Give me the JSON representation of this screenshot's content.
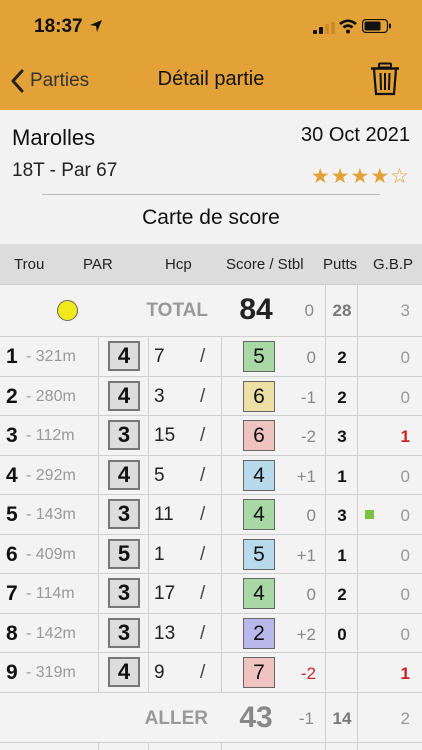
{
  "status": {
    "time": "18:37"
  },
  "nav": {
    "back_label": "Parties",
    "title": "Détail partie"
  },
  "info": {
    "course": "Marolles",
    "date": "30 Oct 2021",
    "par_info": "18T - Par 67",
    "rating": 4,
    "rating_max": 5,
    "rating_text": "★★★★☆",
    "card_title": "Carte de score"
  },
  "table": {
    "headers": {
      "trou": "Trou",
      "par": "PAR",
      "hcp": "Hcp",
      "score": "Score / Stbl",
      "putts": "Putts",
      "gbp": "G.B.P"
    },
    "total": {
      "label": "TOTAL",
      "score": "84",
      "stbl": "0",
      "putts": "28",
      "gbp": "3"
    },
    "holes": [
      {
        "num": "1",
        "dist": "- 321m",
        "par": "4",
        "hcp": "7",
        "slash": "/",
        "score": "5",
        "score_color": "#a8d8a4",
        "stbl": "0",
        "putts": "2",
        "gbp": "0",
        "gbp_red": false,
        "green": false
      },
      {
        "num": "2",
        "dist": "- 280m",
        "par": "4",
        "hcp": "3",
        "slash": "/",
        "score": "6",
        "score_color": "#ece0a4",
        "stbl": "-1",
        "putts": "2",
        "gbp": "0",
        "gbp_red": false,
        "green": false
      },
      {
        "num": "3",
        "dist": "- 112m",
        "par": "3",
        "hcp": "15",
        "slash": "/",
        "score": "6",
        "score_color": "#efc4c0",
        "stbl": "-2",
        "putts": "3",
        "gbp": "1",
        "gbp_red": true,
        "green": false
      },
      {
        "num": "4",
        "dist": "- 292m",
        "par": "4",
        "hcp": "5",
        "slash": "/",
        "score": "4",
        "score_color": "#b7dbea",
        "stbl": "+1",
        "putts": "1",
        "gbp": "0",
        "gbp_red": false,
        "green": false
      },
      {
        "num": "5",
        "dist": "- 143m",
        "par": "3",
        "hcp": "11",
        "slash": "/",
        "score": "4",
        "score_color": "#a8d8a4",
        "stbl": "0",
        "putts": "3",
        "gbp": "0",
        "gbp_red": false,
        "green": true
      },
      {
        "num": "6",
        "dist": "- 409m",
        "par": "5",
        "hcp": "1",
        "slash": "/",
        "score": "5",
        "score_color": "#b7dbea",
        "stbl": "+1",
        "putts": "1",
        "gbp": "0",
        "gbp_red": false,
        "green": false
      },
      {
        "num": "7",
        "dist": "- 114m",
        "par": "3",
        "hcp": "17",
        "slash": "/",
        "score": "4",
        "score_color": "#a8d8a4",
        "stbl": "0",
        "putts": "2",
        "gbp": "0",
        "gbp_red": false,
        "green": false
      },
      {
        "num": "8",
        "dist": "- 142m",
        "par": "3",
        "hcp": "13",
        "slash": "/",
        "score": "2",
        "score_color": "#b8b8ea",
        "stbl": "+2",
        "putts": "0",
        "gbp": "0",
        "gbp_red": false,
        "green": false
      },
      {
        "num": "9",
        "dist": "- 319m",
        "par": "4",
        "hcp": "9",
        "slash": "/",
        "score": "7",
        "score_color": "#efc4c0",
        "stbl": "-2",
        "stbl_red": true,
        "putts": "",
        "gbp": "1",
        "gbp_red": true,
        "green": false
      }
    ],
    "aller": {
      "label": "ALLER",
      "score": "43",
      "stbl": "-1",
      "putts": "14",
      "gbp": "2"
    }
  },
  "colors": {
    "accent": "#e2a238",
    "star": "#e2a238",
    "red": "#cc2222",
    "green_marker": "#7ac142",
    "ball": "#f0ea1a"
  }
}
